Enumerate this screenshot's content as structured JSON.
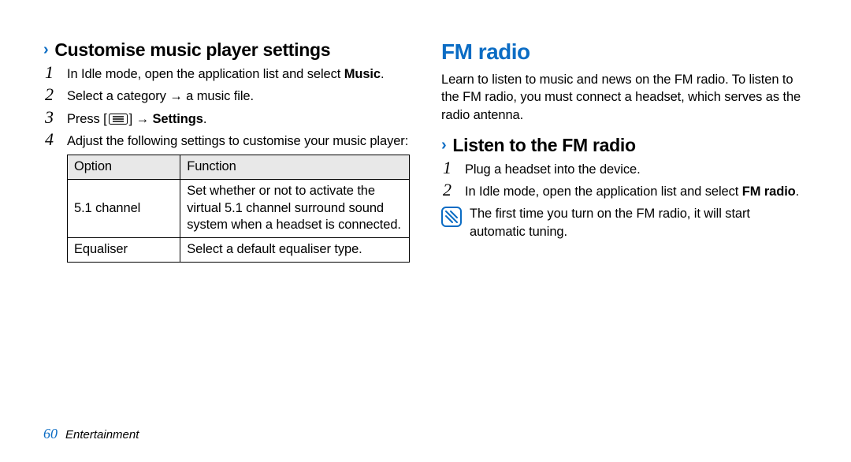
{
  "left": {
    "heading": "Customise music player settings",
    "steps": {
      "s1_a": "In Idle mode, open the application list and select ",
      "s1_b": "Music",
      "s1_c": ".",
      "s2": "Select a category → a music file.",
      "s3_a": "Press [",
      "s3_b": "] → ",
      "s3_c": "Settings",
      "s3_d": ".",
      "s4": "Adjust the following settings to customise your music player:"
    },
    "table": {
      "h1": "Option",
      "h2": "Function",
      "r1c1": "5.1 channel",
      "r1c2": "Set whether or not to activate the virtual 5.1 channel surround sound system when a headset is connected.",
      "r2c1": "Equaliser",
      "r2c2": "Select a default equaliser type."
    }
  },
  "right": {
    "h1": "FM radio",
    "intro": "Learn to listen to music and news on the FM radio. To listen to the FM radio, you must connect a headset, which serves as the radio antenna.",
    "heading": "Listen to the FM radio",
    "steps": {
      "s1": "Plug a headset into the device.",
      "s2_a": "In Idle mode, open the application list and select ",
      "s2_b": "FM radio",
      "s2_c": "."
    },
    "note": "The first time you turn on the FM radio, it will start automatic tuning."
  },
  "footer": {
    "page": "60",
    "section": "Entertainment"
  }
}
